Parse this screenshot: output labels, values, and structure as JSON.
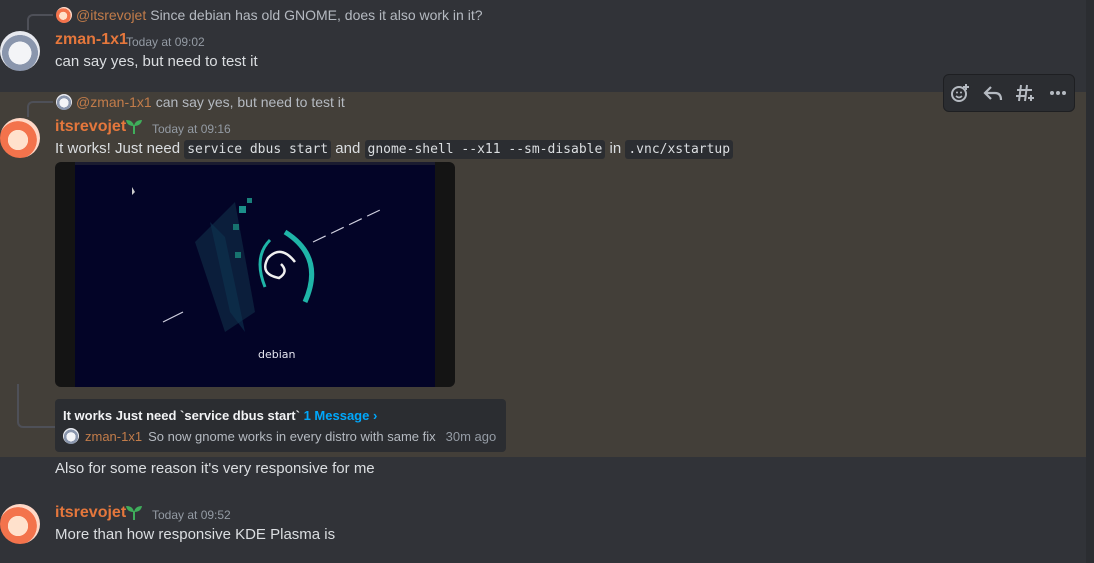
{
  "colors": {
    "background": "#313338",
    "highlight": "#433f39",
    "username": "#e5773c",
    "mention": "#c27c4a",
    "link": "#00a8fc"
  },
  "messages": [
    {
      "reply": {
        "mention": "@itsrevojet",
        "text": "Since debian has old GNOME, does it also work in it?"
      },
      "author": "zman-1x1",
      "timestamp": "Today at 09:02",
      "text": "can say yes, but need to test it"
    },
    {
      "reply": {
        "mention": "@zman-1x1",
        "text": "can say yes, but need to test it"
      },
      "author": "itsrevojet",
      "badge_icon": "sprout-icon",
      "timestamp": "Today at 09:16",
      "parts": {
        "t1": "It works! Just need",
        "c1": "service dbus start",
        "t2": "and",
        "c2": "gnome-shell --x11 --sm-disable",
        "t3": "in",
        "c3": ".vnc/xstartup"
      },
      "attachment": {
        "wordmark": "debian"
      },
      "thread": {
        "title": "It works Just need `service dbus start`",
        "count": "1 Message ›",
        "last_author": "zman-1x1",
        "last_text": "So now gnome works in every distro with same fix",
        "ago": "30m ago"
      },
      "followup": "Also for some reason it's very responsive for me"
    },
    {
      "author": "itsrevojet",
      "badge_icon": "sprout-icon",
      "timestamp": "Today at 09:52",
      "text": "More than how responsive KDE Plasma is"
    }
  ],
  "toolbar": {
    "icons": [
      "add-reaction-icon",
      "reply-icon",
      "create-thread-icon",
      "more-options-icon"
    ]
  }
}
